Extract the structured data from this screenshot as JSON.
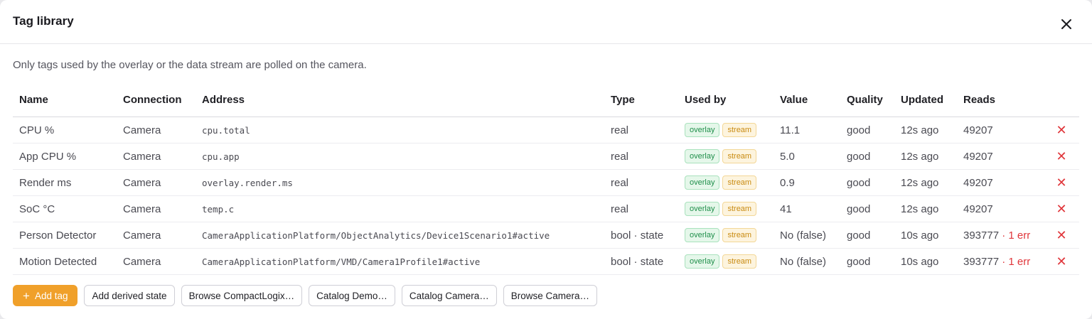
{
  "dialog": {
    "title": "Tag library",
    "hint": "Only tags used by the overlay or the data stream are polled on the camera."
  },
  "table": {
    "headers": [
      "Name",
      "Connection",
      "Address",
      "Type",
      "Used by",
      "Value",
      "Quality",
      "Updated",
      "Reads"
    ],
    "rows": [
      {
        "name": "CPU %",
        "connection": "Camera",
        "address": "cpu.total",
        "type": "real",
        "used_by": [
          "overlay",
          "stream"
        ],
        "value": "11.1",
        "quality": "good",
        "updated": "12s ago",
        "reads": "49207",
        "errors": ""
      },
      {
        "name": "App CPU %",
        "connection": "Camera",
        "address": "cpu.app",
        "type": "real",
        "used_by": [
          "overlay",
          "stream"
        ],
        "value": "5.0",
        "quality": "good",
        "updated": "12s ago",
        "reads": "49207",
        "errors": ""
      },
      {
        "name": "Render ms",
        "connection": "Camera",
        "address": "overlay.render.ms",
        "type": "real",
        "used_by": [
          "overlay",
          "stream"
        ],
        "value": "0.9",
        "quality": "good",
        "updated": "12s ago",
        "reads": "49207",
        "errors": ""
      },
      {
        "name": "SoC °C",
        "connection": "Camera",
        "address": "temp.c",
        "type": "real",
        "used_by": [
          "overlay",
          "stream"
        ],
        "value": "41",
        "quality": "good",
        "updated": "12s ago",
        "reads": "49207",
        "errors": ""
      },
      {
        "name": "Person Detector",
        "connection": "Camera",
        "address": "CameraApplicationPlatform/ObjectAnalytics/Device1Scenario1#active",
        "type": "bool · state",
        "used_by": [
          "overlay",
          "stream"
        ],
        "value": "No (false)",
        "quality": "good",
        "updated": "10s ago",
        "reads": "393777",
        "errors": "· 1 err"
      },
      {
        "name": "Motion Detected",
        "connection": "Camera",
        "address": "CameraApplicationPlatform/VMD/Camera1Profile1#active",
        "type": "bool · state",
        "used_by": [
          "overlay",
          "stream"
        ],
        "value": "No (false)",
        "quality": "good",
        "updated": "10s ago",
        "reads": "393777",
        "errors": "· 1 err"
      }
    ],
    "delete_glyph": "✕"
  },
  "footer": {
    "add_tag_icon": "+",
    "add_tag": "Add tag",
    "buttons": [
      "Add derived state",
      "Browse CompactLogix…",
      "Catalog Demo…",
      "Catalog Camera…",
      "Browse Camera…"
    ]
  },
  "colors": {
    "accent": "#f0a02a",
    "good": "#1aa64f",
    "error": "#e0363b",
    "overlay_badge": "#1f8f4a",
    "stream_badge": "#c98b12"
  },
  "icons": {
    "close": "close-icon",
    "delete": "delete-icon",
    "add": "plus-icon"
  }
}
